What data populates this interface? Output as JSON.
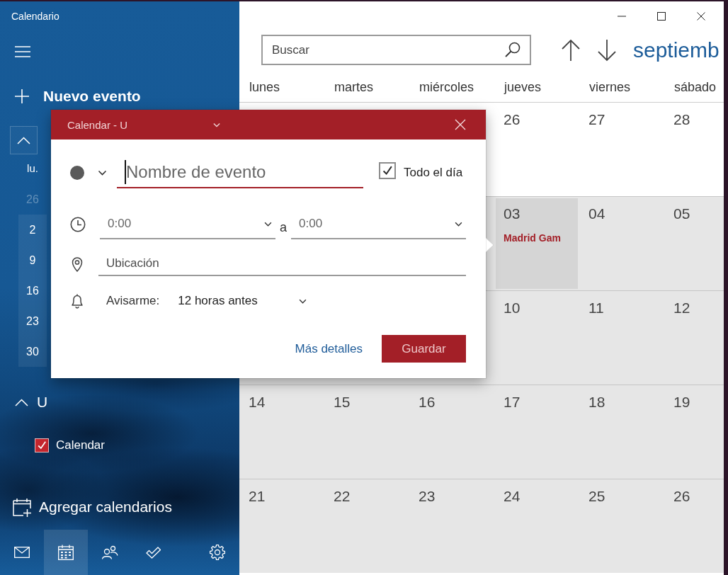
{
  "window": {
    "title": "Calendario",
    "controls": [
      {
        "kind": "minimize"
      },
      {
        "kind": "maximize"
      },
      {
        "kind": "close"
      }
    ]
  },
  "sidebar": {
    "new_event": "Nuevo evento",
    "mini_calendar": {
      "weekday": "lu.",
      "days": [
        {
          "day": "26",
          "in_month": false
        },
        {
          "day": "2",
          "in_month": true
        },
        {
          "day": "9",
          "in_month": true
        },
        {
          "day": "16",
          "in_month": true
        },
        {
          "day": "23",
          "in_month": true
        },
        {
          "day": "30",
          "in_month": true
        }
      ]
    },
    "account": {
      "name": "U",
      "expanded": true
    },
    "calendars": [
      {
        "label": "Calendar",
        "checked": true
      }
    ],
    "add_calendars": "Agregar calendarios",
    "nav": [
      {
        "kind": "mail",
        "selected": false
      },
      {
        "kind": "calendar",
        "selected": true
      },
      {
        "kind": "people",
        "selected": false
      },
      {
        "kind": "tasks",
        "selected": false
      },
      {
        "kind": "settings",
        "selected": false
      }
    ]
  },
  "toolbar": {
    "search": {
      "placeholder": "Buscar"
    },
    "month_title": "septiemb"
  },
  "month_view": {
    "weekdays": [
      "lunes",
      "martes",
      "miércoles",
      "jueves",
      "viernes",
      "sábado"
    ],
    "weeks": [
      {
        "days": [
          {
            "day": "26",
            "in_month": false,
            "selected": false
          },
          {
            "day": "27",
            "in_month": false,
            "selected": false
          },
          {
            "day": "28",
            "in_month": false,
            "selected": false
          }
        ]
      },
      {
        "days": [
          {
            "day": "03",
            "in_month": true,
            "selected": true,
            "events": [
              {
                "title": "Madrid Gam"
              }
            ]
          },
          {
            "day": "04",
            "in_month": true,
            "selected": false
          },
          {
            "day": "05",
            "in_month": true,
            "selected": false
          }
        ]
      },
      {
        "days": [
          {
            "day": "10",
            "in_month": true,
            "selected": false
          },
          {
            "day": "11",
            "in_month": true,
            "selected": false
          },
          {
            "day": "12",
            "in_month": true,
            "selected": false
          }
        ]
      },
      {
        "days": [
          {
            "day": "14",
            "in_month": true,
            "selected": false
          },
          {
            "day": "15",
            "in_month": true,
            "selected": false
          },
          {
            "day": "16",
            "in_month": true,
            "selected": false
          },
          {
            "day": "17",
            "in_month": true,
            "selected": false
          },
          {
            "day": "18",
            "in_month": true,
            "selected": false
          },
          {
            "day": "19",
            "in_month": true,
            "selected": false
          }
        ]
      },
      {
        "days": [
          {
            "day": "21",
            "in_month": true,
            "selected": false
          },
          {
            "day": "22",
            "in_month": true,
            "selected": false
          },
          {
            "day": "23",
            "in_month": true,
            "selected": false
          },
          {
            "day": "24",
            "in_month": true,
            "selected": false
          },
          {
            "day": "25",
            "in_month": true,
            "selected": false
          },
          {
            "day": "26",
            "in_month": true,
            "selected": false
          }
        ]
      }
    ]
  },
  "popup": {
    "calendar_name": "Calendar - U",
    "event_name": {
      "placeholder": "Nombre de evento",
      "focused": true
    },
    "all_day": {
      "label": "Todo el día",
      "checked": true
    },
    "start_time": "0:00",
    "time_separator": "a",
    "end_time": "0:00",
    "location": {
      "placeholder": "Ubicación"
    },
    "reminder": {
      "label": "Avisarme:",
      "value": "12 horas antes"
    },
    "more_details": "Más detalles",
    "save": "Guardar"
  }
}
